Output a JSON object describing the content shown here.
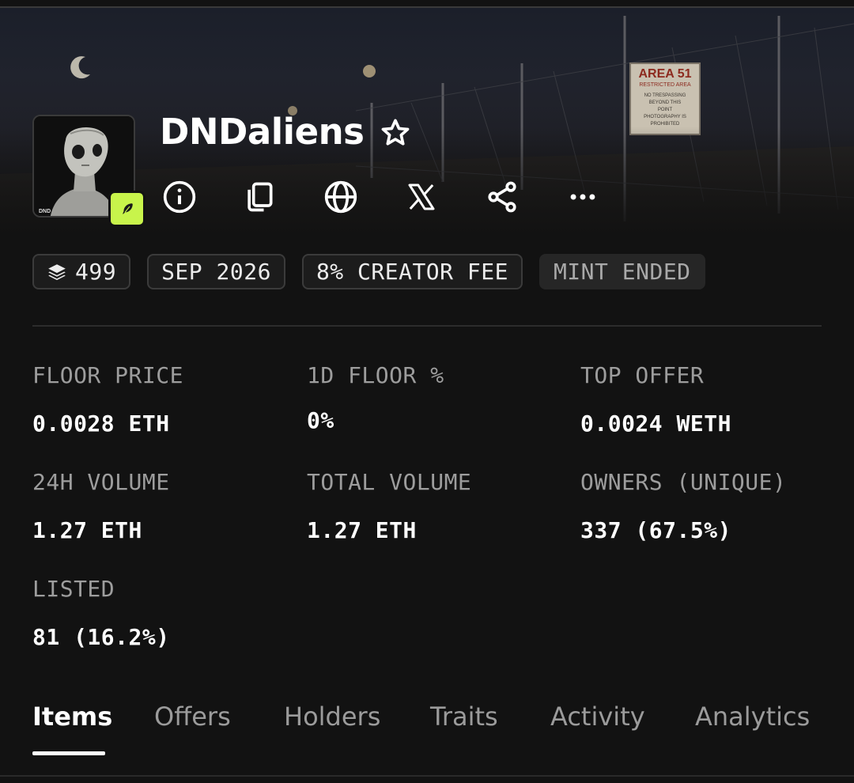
{
  "collection": {
    "name": "DNDaliens",
    "avatar_label": "DND",
    "banner_sign": {
      "title": "AREA 51",
      "subtitle": "RESTRICTED AREA",
      "lines": [
        "NO TRESPASSING",
        "BEYOND THIS",
        "POINT",
        "PHOTOGRAPHY IS",
        "PROHIBITED"
      ]
    }
  },
  "actions": [
    {
      "icon": "info-icon"
    },
    {
      "icon": "copy-icon"
    },
    {
      "icon": "globe-icon"
    },
    {
      "icon": "x-logo-icon"
    },
    {
      "icon": "share-icon"
    },
    {
      "icon": "more-icon"
    }
  ],
  "pills": {
    "items_count": "499",
    "date": "SEP 2026",
    "creator_fee": "8% CREATOR FEE",
    "mint_status": "MINT ENDED"
  },
  "stats": [
    {
      "label": "FLOOR PRICE",
      "value": "0.0028 ETH"
    },
    {
      "label": "1D FLOOR %",
      "value": "0%"
    },
    {
      "label": "TOP OFFER",
      "value": "0.0024 WETH"
    },
    {
      "label": "24H VOLUME",
      "value": "1.27 ETH"
    },
    {
      "label": "TOTAL VOLUME",
      "value": "1.27 ETH"
    },
    {
      "label": "OWNERS (UNIQUE)",
      "value": "337 (67.5%)"
    },
    {
      "label": "LISTED",
      "value": "81 (16.2%)"
    }
  ],
  "tabs": [
    "Items",
    "Offers",
    "Holders",
    "Traits",
    "Activity",
    "Analytics"
  ],
  "active_tab": "Items",
  "colors": {
    "accent": "#c8f44b",
    "background": "#121212"
  }
}
